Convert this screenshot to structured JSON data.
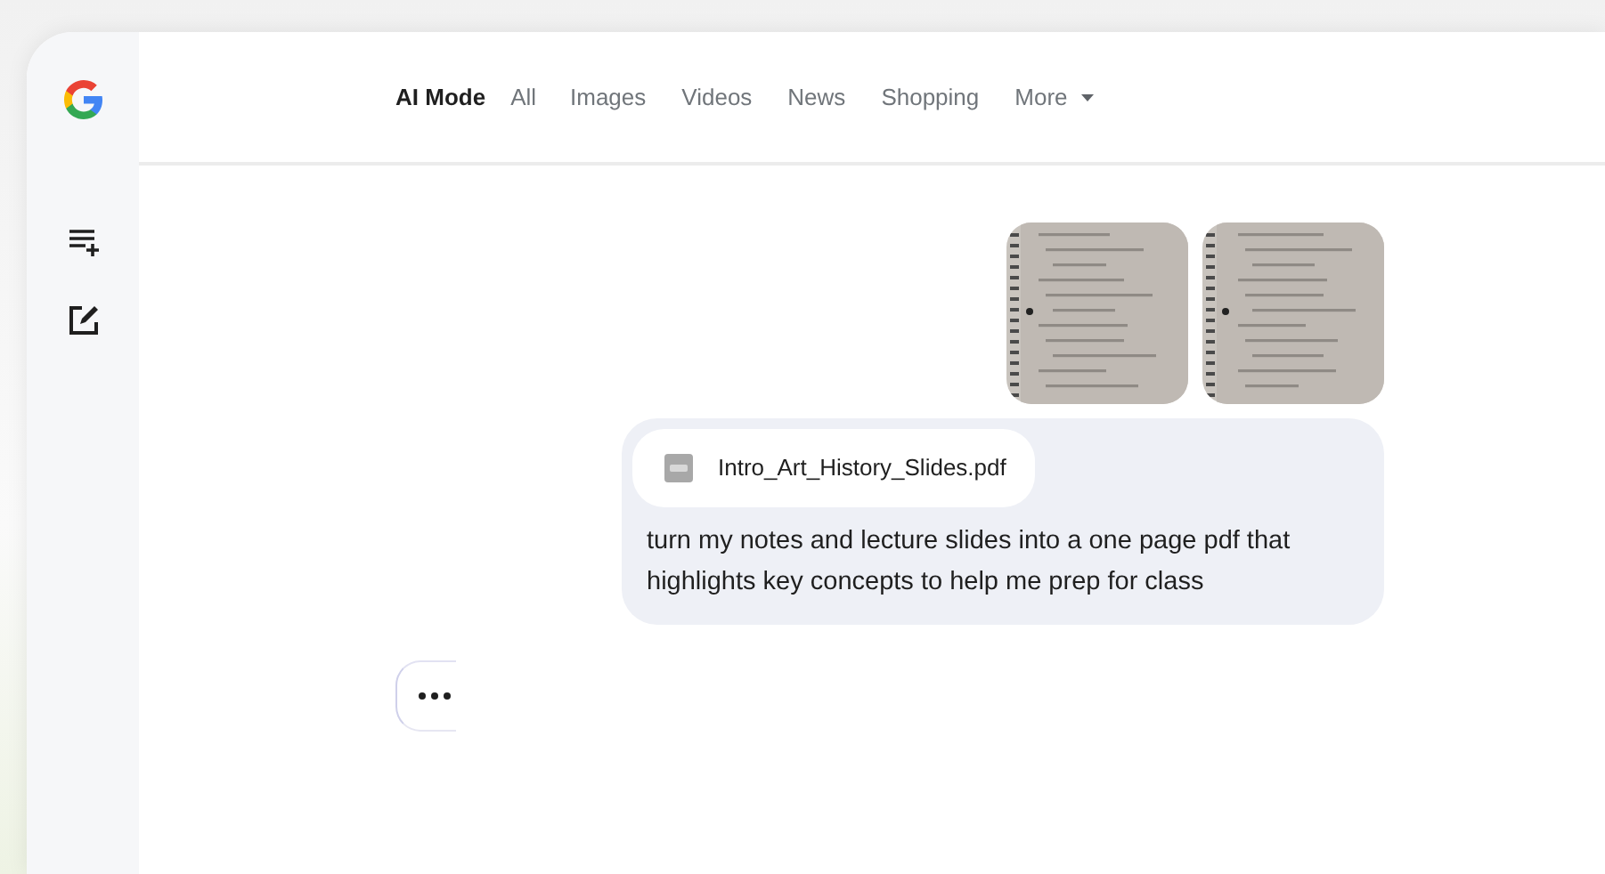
{
  "tabs": [
    {
      "label": "AI Mode",
      "selected": true
    },
    {
      "label": "All",
      "selected": false
    },
    {
      "label": "Images",
      "selected": false
    },
    {
      "label": "Videos",
      "selected": false
    },
    {
      "label": "News",
      "selected": false
    },
    {
      "label": "Shopping",
      "selected": false
    },
    {
      "label": "More",
      "selected": false,
      "kind": "dropdown"
    }
  ],
  "message": {
    "attachment": {
      "name": "Intro_Art_History_Slides.pdf"
    },
    "text": "turn my notes and lecture slides into a one page pdf that highlights key concepts to help me prep for class"
  },
  "response": {
    "loading": true
  }
}
